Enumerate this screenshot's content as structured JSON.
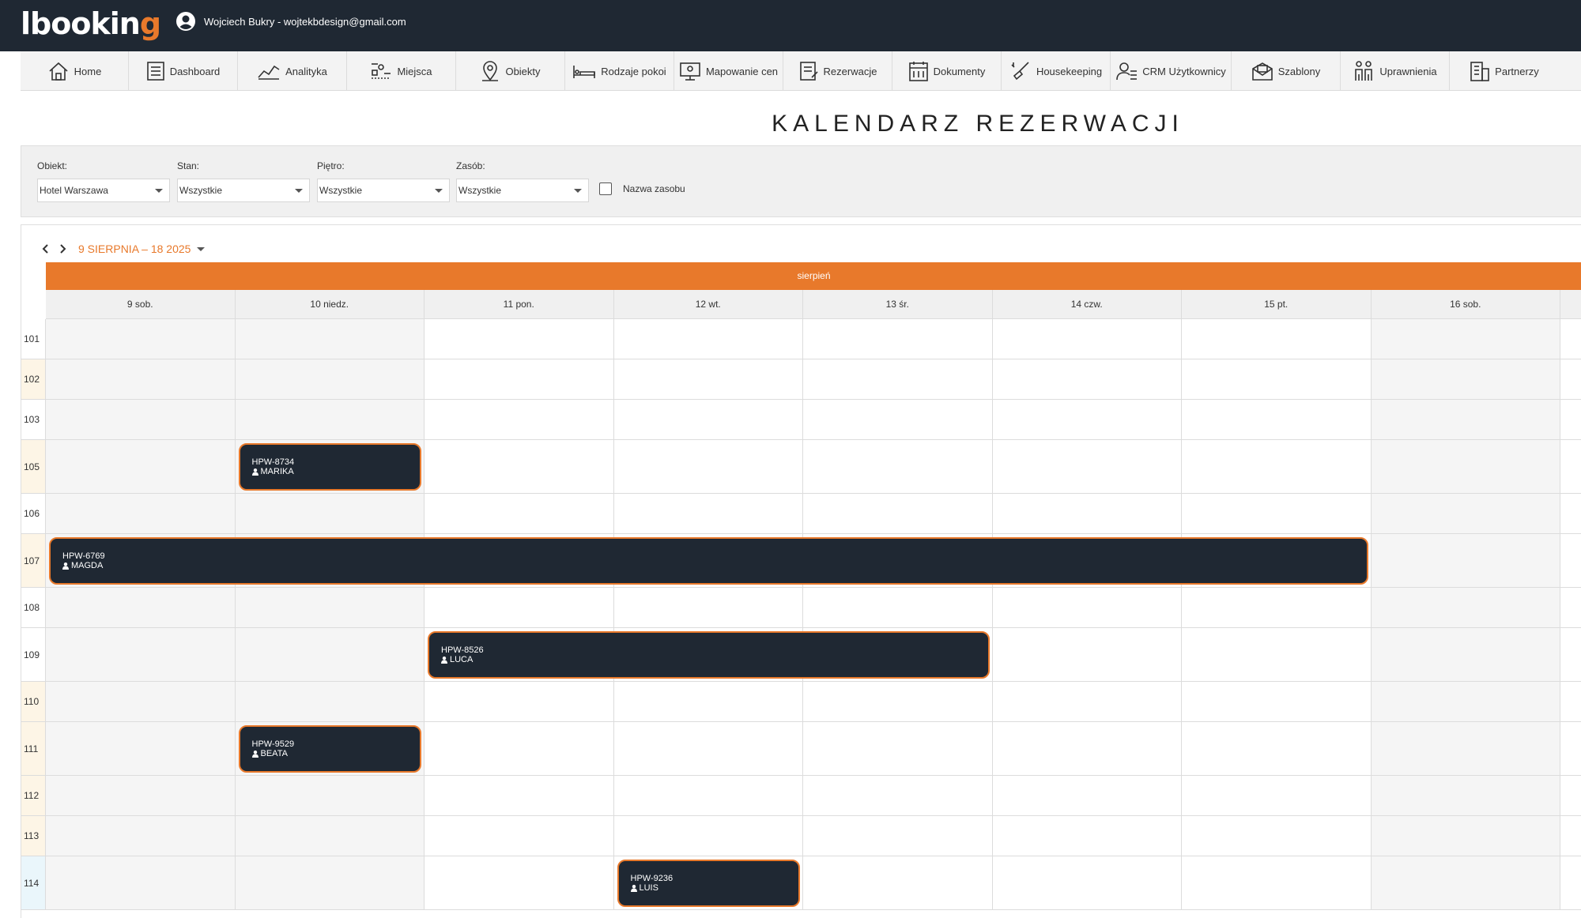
{
  "app": {
    "logo_prefix": "l",
    "logo_main": "booki",
    "logo_accent": "n",
    "logo_end": "g",
    "user": "Wojciech Bukry - wojtekbdesign@gmail.com"
  },
  "nav": [
    {
      "label": "Home",
      "icon": "home-icon"
    },
    {
      "label": "Dashboard",
      "icon": "dashboard-icon"
    },
    {
      "label": "Analityka",
      "icon": "analytics-icon"
    },
    {
      "label": "Miejsca",
      "icon": "places-icon"
    },
    {
      "label": "Obiekty",
      "icon": "location-pin-icon"
    },
    {
      "label": "Rodzaje pokoi",
      "icon": "bed-icon"
    },
    {
      "label": "Mapowanie cen",
      "icon": "price-mapping-icon"
    },
    {
      "label": "Rezerwacje",
      "icon": "reservations-icon"
    },
    {
      "label": "Dokumenty",
      "icon": "documents-icon"
    },
    {
      "label": "Housekeeping",
      "icon": "housekeeping-icon"
    },
    {
      "label": "CRM Użytkownicy",
      "icon": "crm-users-icon"
    },
    {
      "label": "Szablony",
      "icon": "templates-icon"
    },
    {
      "label": "Uprawnienia",
      "icon": "permissions-icon"
    },
    {
      "label": "Partnerzy",
      "icon": "partners-icon"
    }
  ],
  "title": "KALENDARZ REZERWACJI",
  "filters": {
    "obiekt_label": "Obiekt:",
    "obiekt_value": "Hotel Warszawa",
    "stan_label": "Stan:",
    "stan_value": "Wszystkie",
    "pietro_label": "Piętro:",
    "pietro_value": "Wszystkie",
    "zasob_label": "Zasób:",
    "zasob_value": "Wszystkie",
    "checkbox_label": "Nazwa zasobu"
  },
  "calendar": {
    "range": "9 SIERPNIA – 18 2025",
    "month": "sierpień",
    "days": [
      {
        "label": "9 sob.",
        "weekend": true
      },
      {
        "label": "10 niedz.",
        "weekend": true
      },
      {
        "label": "11 pon.",
        "weekend": false
      },
      {
        "label": "12 wt.",
        "weekend": false
      },
      {
        "label": "13 śr.",
        "weekend": false
      },
      {
        "label": "14 czw.",
        "weekend": false
      },
      {
        "label": "15 pt.",
        "weekend": false
      },
      {
        "label": "16 sob.",
        "weekend": true
      }
    ],
    "rooms": [
      {
        "label": "101",
        "accent": "#ffffff"
      },
      {
        "label": "102",
        "accent": "#fdf5e6"
      },
      {
        "label": "103",
        "accent": "#ffffff"
      },
      {
        "label": "105",
        "accent": "#fdf5e6"
      },
      {
        "label": "106",
        "accent": "#ffffff"
      },
      {
        "label": "107",
        "accent": "#fdf5e6"
      },
      {
        "label": "108",
        "accent": "#ffffff"
      },
      {
        "label": "109",
        "accent": "#ffffff"
      },
      {
        "label": "110",
        "accent": "#fdf5e6"
      },
      {
        "label": "111",
        "accent": "#fdf5e6"
      },
      {
        "label": "112",
        "accent": "#fdf5e6"
      },
      {
        "label": "113",
        "accent": "#fdf5e6"
      },
      {
        "label": "114",
        "accent": "#eaf6fb"
      }
    ],
    "bookings": [
      {
        "code": "HPW-8734",
        "guest": "MARIKA",
        "room": 3,
        "start": 1,
        "end": 2
      },
      {
        "code": "HPW-6769",
        "guest": "MAGDA",
        "room": 5,
        "start": 0,
        "end": 7
      },
      {
        "code": "HPW-8526",
        "guest": "LUCA",
        "room": 7,
        "start": 2,
        "end": 5
      },
      {
        "code": "HPW-9529",
        "guest": "BEATA",
        "room": 9,
        "start": 1,
        "end": 2
      },
      {
        "code": "HPW-9236",
        "guest": "LUIS",
        "room": 12,
        "start": 3,
        "end": 4
      }
    ]
  },
  "colors": {
    "brand_orange": "#e8792b",
    "dark": "#1f2833"
  }
}
